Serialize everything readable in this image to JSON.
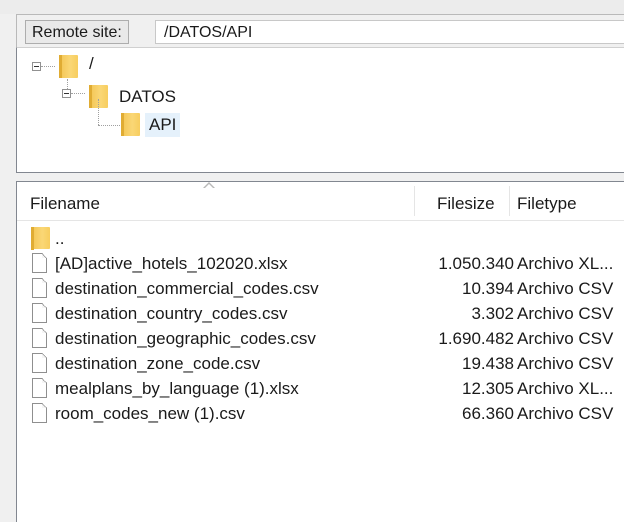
{
  "site_bar": {
    "label": "Remote site:",
    "path": "/DATOS/API"
  },
  "tree": {
    "nodes": [
      {
        "label": "/"
      },
      {
        "label": "DATOS"
      },
      {
        "label": "API"
      }
    ]
  },
  "file_list": {
    "columns": {
      "filename": "Filename",
      "filesize": "Filesize",
      "filetype": "Filetype"
    },
    "parent_dir": "..",
    "files": [
      {
        "name": "[AD]active_hotels_102020.xlsx",
        "size": "1.050.340",
        "type": "Archivo XL..."
      },
      {
        "name": "destination_commercial_codes.csv",
        "size": "10.394",
        "type": "Archivo CSV"
      },
      {
        "name": "destination_country_codes.csv",
        "size": "3.302",
        "type": "Archivo CSV"
      },
      {
        "name": "destination_geographic_codes.csv",
        "size": "1.690.482",
        "type": "Archivo CSV"
      },
      {
        "name": "destination_zone_code.csv",
        "size": "19.438",
        "type": "Archivo CSV"
      },
      {
        "name": "mealplans_by_language (1).xlsx",
        "size": "12.305",
        "type": "Archivo XL..."
      },
      {
        "name": "room_codes_new (1).csv",
        "size": "66.360",
        "type": "Archivo CSV"
      }
    ]
  },
  "icons": {
    "folder": "folder-icon",
    "file": "file-icon",
    "collapse": "collapse-icon",
    "sort": "sort-ascending-icon"
  },
  "colors": {
    "folder": "#f7cd5e",
    "selection": "#e5f1fb",
    "pane_border": "#828790"
  }
}
